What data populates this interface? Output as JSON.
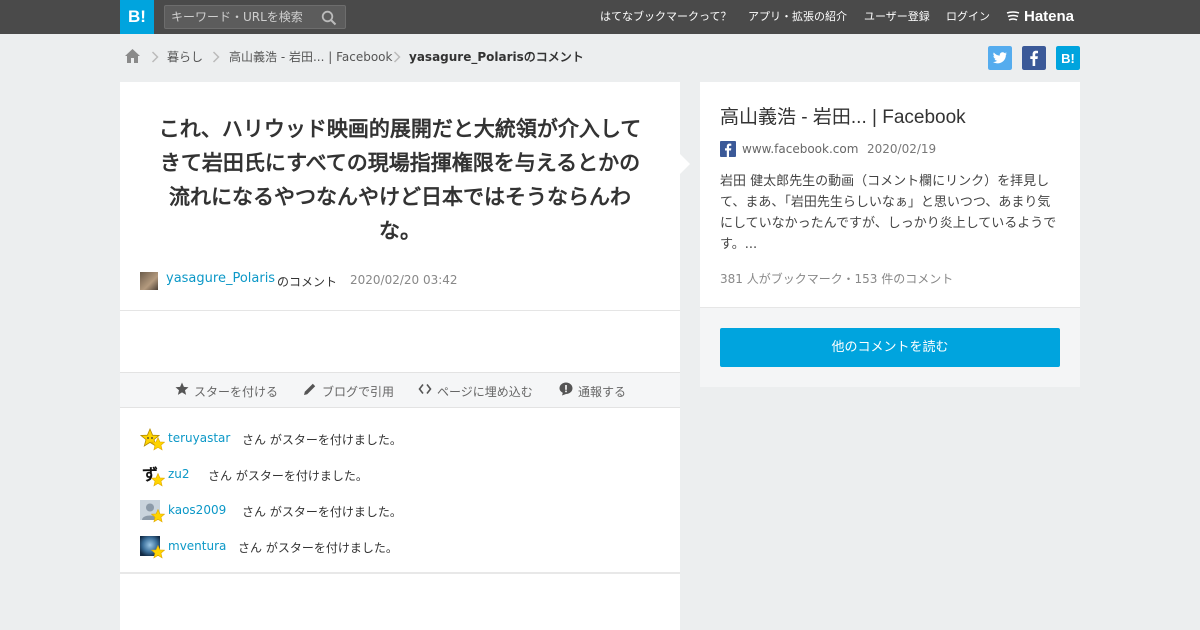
{
  "header": {
    "logo_text": "B!",
    "search_placeholder": "キーワード・URLを検索",
    "nav": [
      "はてなブックマークって？",
      "アプリ・拡張の紹介",
      "ユーザー登録",
      "ログイン"
    ],
    "brand": "Hatena"
  },
  "breadcrumb": {
    "items": [
      "暮らし",
      "高山義浩 - 岩田... | Facebook",
      "yasagure_Polarisのコメント"
    ]
  },
  "comment": {
    "text": "これ、ハリウッド映画的展開だと大統領が介入してきて岩田氏にすべての現場指揮権限を与えるとかの流れになるやつなんやけど日本ではそうならんわな。",
    "user": "yasagure_Polaris",
    "user_suffix": "のコメント",
    "date": "2020/02/20 03:42"
  },
  "actions": [
    "スターを付ける",
    "ブログで引用",
    "ページに埋め込む",
    "通報する"
  ],
  "stars": {
    "message": "さん がスターを付けました。",
    "users": [
      "teruyastar",
      "zu2",
      "kaos2009",
      "mventura"
    ]
  },
  "entry": {
    "title": "高山義浩 - 岩田... | Facebook",
    "domain": "www.facebook.com",
    "date": "2020/02/19",
    "description": "岩田 健太郎先生の動画（コメント欄にリンク）を拝見して、まあ、「岩田先生らしいなぁ」と思いつつ、あまり気にしていなかったんですが、しっかり炎上しているようです。...",
    "bookmark_count": "381 人がブックマーク・153 件のコメント",
    "read_more": "他のコメントを読む"
  },
  "colors": {
    "accent": "#00a4de",
    "link": "#0c98c7",
    "header_bg": "#4a4a4a",
    "twitter": "#55acee",
    "facebook": "#3b5998",
    "star": "#ffd400"
  },
  "icons": {
    "search": "search-icon",
    "home": "home-icon",
    "chevron": "chevron-right-icon",
    "star": "star-icon",
    "pencil": "pencil-icon",
    "code": "code-icon",
    "alert": "alert-icon"
  }
}
